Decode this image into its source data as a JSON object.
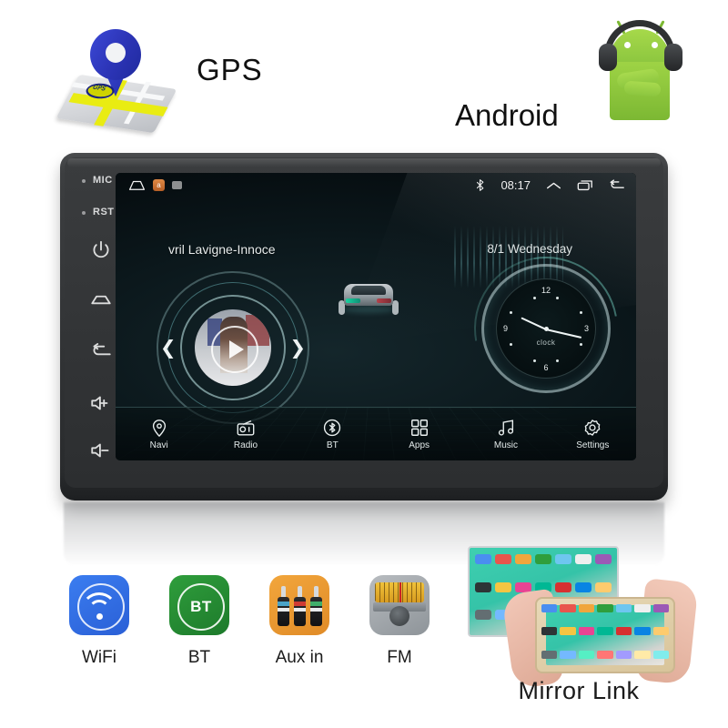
{
  "features_top": {
    "gps_label": "GPS",
    "gps_icon": "map-pin-icon",
    "android_label": "Android",
    "android_icon": "android-robot-headphones-icon"
  },
  "head_unit": {
    "side_keys": [
      {
        "name": "mic-indicator",
        "label": "MIC",
        "icon": "dot-indicator"
      },
      {
        "name": "reset-button",
        "label": "RST",
        "icon": "dot-indicator"
      },
      {
        "name": "power-button",
        "label": "",
        "icon": "power-icon"
      },
      {
        "name": "home-button",
        "label": "",
        "icon": "home-icon"
      },
      {
        "name": "back-button",
        "label": "",
        "icon": "back-arrow-icon"
      },
      {
        "name": "volume-up-button",
        "label": "",
        "icon": "volume-up-icon"
      },
      {
        "name": "volume-down-button",
        "label": "",
        "icon": "volume-down-icon"
      }
    ],
    "status_bar": {
      "home_icon": "home-icon",
      "app_badge": "app-icon",
      "gray_badge": "app-icon",
      "bluetooth_icon": "bluetooth-icon",
      "time": "08:17",
      "expand_icon": "chevron-up-icon",
      "recents_icon": "recents-icon",
      "back_icon": "back-arrow-icon"
    },
    "now_playing": {
      "track": "vril Lavigne-Innoce",
      "prev_icon": "chevron-left-icon",
      "next_icon": "chevron-right-icon",
      "play_icon": "play-icon",
      "album_art": "album-art-thumbnail"
    },
    "date": "8/1 Wednesday",
    "clock_widget": {
      "label": "clock",
      "numerals": [
        "12",
        "3",
        "6",
        "9"
      ],
      "hour": 8,
      "minute": 17
    },
    "dock": [
      {
        "label": "Navi",
        "icon": "location-pin-icon"
      },
      {
        "label": "Radio",
        "icon": "radio-icon"
      },
      {
        "label": "BT",
        "icon": "bluetooth-icon"
      },
      {
        "label": "Apps",
        "icon": "app-grid-icon"
      },
      {
        "label": "Music",
        "icon": "music-note-icon"
      },
      {
        "label": "Settings",
        "icon": "gear-icon"
      }
    ]
  },
  "features_bottom": [
    {
      "label": "WiFi",
      "icon": "wifi-icon",
      "color": "#3b7df0"
    },
    {
      "label": "BT",
      "icon": "bluetooth-badge-icon",
      "color": "#2f9e3c"
    },
    {
      "label": "Aux in",
      "icon": "rca-plugs-icon",
      "color": "#f2a63c"
    },
    {
      "label": "FM",
      "icon": "fm-tuner-icon",
      "color": "#9aa0a5"
    }
  ],
  "mirror_link": {
    "caption": "Mirror Link",
    "tablet_icon": "tablet-screen-mirroring",
    "phone_icon": "phone-in-hands"
  }
}
